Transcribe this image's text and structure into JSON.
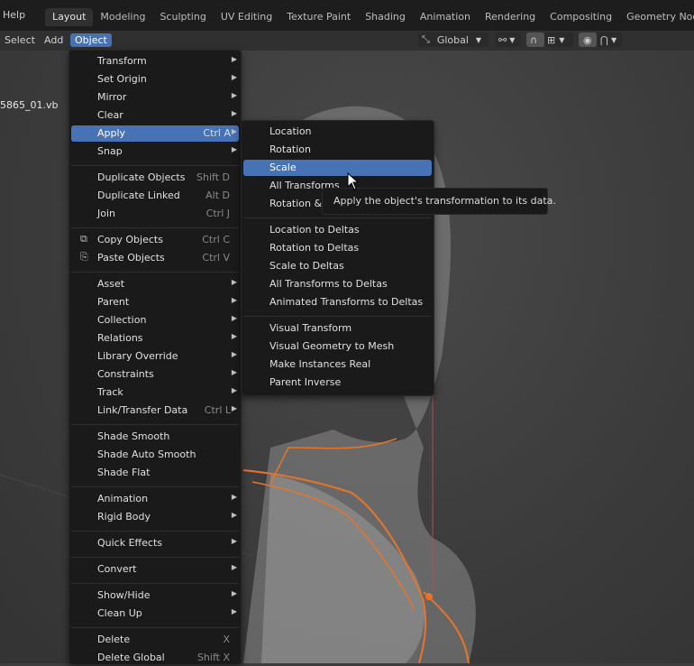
{
  "topbar": {
    "help": "Help",
    "tabs": [
      "Layout",
      "Modeling",
      "Sculpting",
      "UV Editing",
      "Texture Paint",
      "Shading",
      "Animation",
      "Rendering",
      "Compositing",
      "Geometry Nodes"
    ],
    "active_tab": "Layout"
  },
  "header": {
    "menus": [
      "Select",
      "Add",
      "Object"
    ],
    "active_menu": "Object",
    "orientation": "Global"
  },
  "viewport": {
    "object_name": "5865_01.vb"
  },
  "object_menu": {
    "items": [
      {
        "label": "Transform",
        "shortcut": "",
        "submenu": true
      },
      {
        "label": "Set Origin",
        "shortcut": "",
        "submenu": true
      },
      {
        "label": "Mirror",
        "shortcut": "",
        "submenu": true
      },
      {
        "label": "Clear",
        "shortcut": "",
        "submenu": true
      },
      {
        "label": "Apply",
        "shortcut": "Ctrl A",
        "submenu": true,
        "highlighted": true
      },
      {
        "label": "Snap",
        "shortcut": "",
        "submenu": true
      },
      {
        "sep": true
      },
      {
        "label": "Duplicate Objects",
        "shortcut": "Shift D"
      },
      {
        "label": "Duplicate Linked",
        "shortcut": "Alt D"
      },
      {
        "label": "Join",
        "shortcut": "Ctrl J"
      },
      {
        "sep": true
      },
      {
        "label": "Copy Objects",
        "shortcut": "Ctrl C",
        "icon": "copy-icon"
      },
      {
        "label": "Paste Objects",
        "shortcut": "Ctrl V",
        "icon": "paste-icon"
      },
      {
        "sep": true
      },
      {
        "label": "Asset",
        "shortcut": "",
        "submenu": true
      },
      {
        "label": "Parent",
        "shortcut": "",
        "submenu": true
      },
      {
        "label": "Collection",
        "shortcut": "",
        "submenu": true
      },
      {
        "label": "Relations",
        "shortcut": "",
        "submenu": true
      },
      {
        "label": "Library Override",
        "shortcut": "",
        "submenu": true
      },
      {
        "label": "Constraints",
        "shortcut": "",
        "submenu": true
      },
      {
        "label": "Track",
        "shortcut": "",
        "submenu": true
      },
      {
        "label": "Link/Transfer Data",
        "shortcut": "Ctrl L",
        "submenu": true
      },
      {
        "sep": true
      },
      {
        "label": "Shade Smooth",
        "shortcut": ""
      },
      {
        "label": "Shade Auto Smooth",
        "shortcut": ""
      },
      {
        "label": "Shade Flat",
        "shortcut": ""
      },
      {
        "sep": true
      },
      {
        "label": "Animation",
        "shortcut": "",
        "submenu": true
      },
      {
        "label": "Rigid Body",
        "shortcut": "",
        "submenu": true
      },
      {
        "sep": true
      },
      {
        "label": "Quick Effects",
        "shortcut": "",
        "submenu": true
      },
      {
        "sep": true
      },
      {
        "label": "Convert",
        "shortcut": "",
        "submenu": true
      },
      {
        "sep": true
      },
      {
        "label": "Show/Hide",
        "shortcut": "",
        "submenu": true
      },
      {
        "label": "Clean Up",
        "shortcut": "",
        "submenu": true
      },
      {
        "sep": true
      },
      {
        "label": "Delete",
        "shortcut": "X"
      },
      {
        "label": "Delete Global",
        "shortcut": "Shift X"
      }
    ]
  },
  "apply_menu": {
    "items": [
      {
        "label": "Location"
      },
      {
        "label": "Rotation"
      },
      {
        "label": "Scale",
        "highlighted": true
      },
      {
        "label": "All Transforms"
      },
      {
        "label": "Rotation & Scale"
      },
      {
        "sep": true
      },
      {
        "label": "Location to Deltas"
      },
      {
        "label": "Rotation to Deltas"
      },
      {
        "label": "Scale to Deltas"
      },
      {
        "label": "All Transforms to Deltas"
      },
      {
        "label": "Animated Transforms to Deltas"
      },
      {
        "sep": true
      },
      {
        "label": "Visual Transform"
      },
      {
        "label": "Visual Geometry to Mesh"
      },
      {
        "label": "Make Instances Real"
      },
      {
        "label": "Parent Inverse"
      }
    ]
  },
  "tooltip": {
    "text": "Apply the object's transformation to its data."
  },
  "colors": {
    "accent": "#4772b3",
    "menu_bg": "#1a1a1a",
    "mesh_outline": "#e8742a"
  }
}
